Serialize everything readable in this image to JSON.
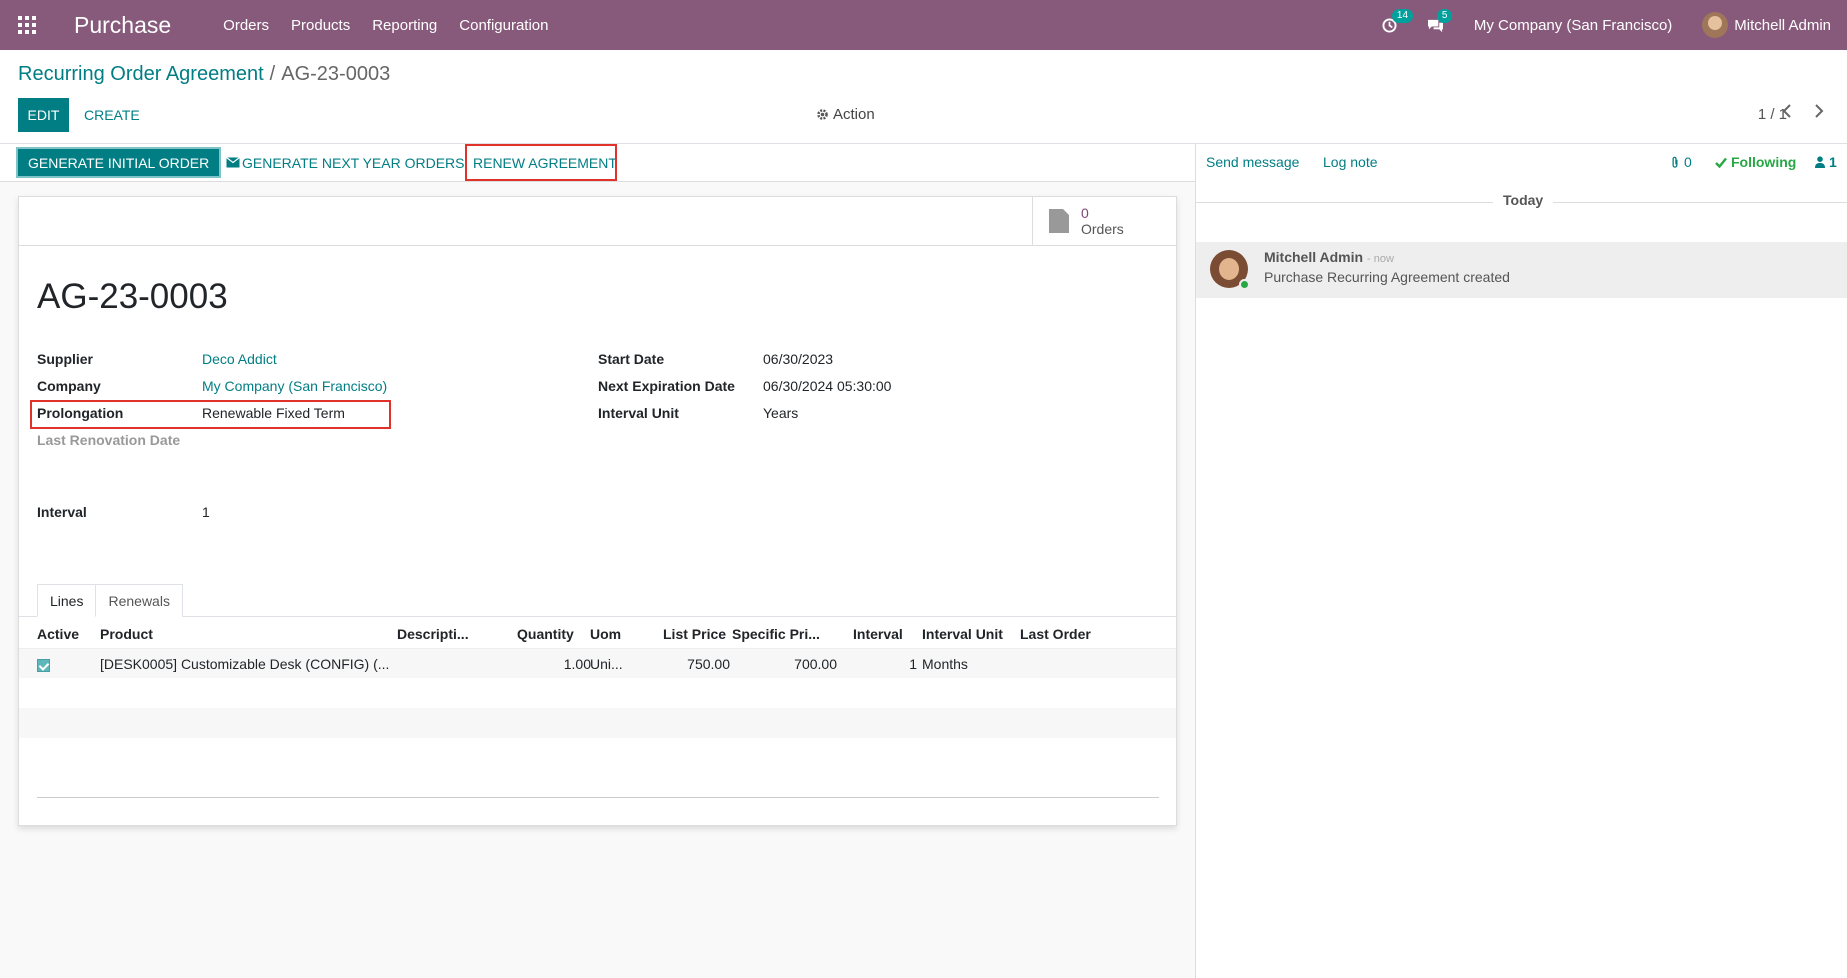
{
  "navbar": {
    "app_name": "Purchase",
    "menu": [
      "Orders",
      "Products",
      "Reporting",
      "Configuration"
    ],
    "activity_count": "14",
    "messages_count": "5",
    "company": "My Company (San Francisco)",
    "user": "Mitchell Admin"
  },
  "breadcrumb": {
    "parent": "Recurring Order Agreement",
    "separator": "/",
    "current": "AG-23-0003"
  },
  "control_panel": {
    "edit_label": "EDIT",
    "create_label": "CREATE",
    "action_label": "Action",
    "pager": "1 / 1"
  },
  "statusbar": {
    "generate_initial": "GENERATE INITIAL ORDER",
    "generate_next": "GENERATE NEXT YEAR ORDERS",
    "renew": "RENEW AGREEMENT"
  },
  "stat_button": {
    "value": "0",
    "label": "Orders"
  },
  "record": {
    "title": "AG-23-0003",
    "left_fields": [
      {
        "label": "Supplier",
        "value": "Deco Addict"
      },
      {
        "label": "Company",
        "value": "My Company (San Francisco)"
      },
      {
        "label": "Prolongation",
        "value": "Renewable Fixed Term"
      },
      {
        "label": "Last Renovation Date",
        "value": ""
      },
      {
        "label": "Interval",
        "value": "1"
      }
    ],
    "right_fields": [
      {
        "label": "Start Date",
        "value": "06/30/2023"
      },
      {
        "label": "Next Expiration Date",
        "value": "06/30/2024 05:30:00"
      },
      {
        "label": "Interval Unit",
        "value": "Years"
      }
    ]
  },
  "tabs": [
    "Lines",
    "Renewals"
  ],
  "lines_table": {
    "columns": [
      "Active",
      "Product",
      "Descripti...",
      "Quantity",
      "Uom",
      "List Price",
      "Specific Pri...",
      "Interval",
      "Interval Unit",
      "Last Order"
    ],
    "rows": [
      {
        "active": true,
        "product": "[DESK0005] Customizable Desk (CONFIG) (...",
        "description": "",
        "quantity": "1.00",
        "uom": "Uni...",
        "list_price": "750.00",
        "specific_price": "700.00",
        "interval": "1",
        "interval_unit": "Months",
        "last_order": ""
      }
    ]
  },
  "chatter": {
    "send_message": "Send message",
    "log_note": "Log note",
    "attachments": "0",
    "following": "Following",
    "followers": "1",
    "date_separator": "Today",
    "messages": [
      {
        "author": "Mitchell Admin",
        "date": "- now",
        "body": "Purchase Recurring Agreement created"
      }
    ]
  },
  "colors": {
    "navbar": "#875a7b",
    "primary": "#017e84",
    "highlight_box": "#e0322a",
    "following": "#28a745"
  }
}
